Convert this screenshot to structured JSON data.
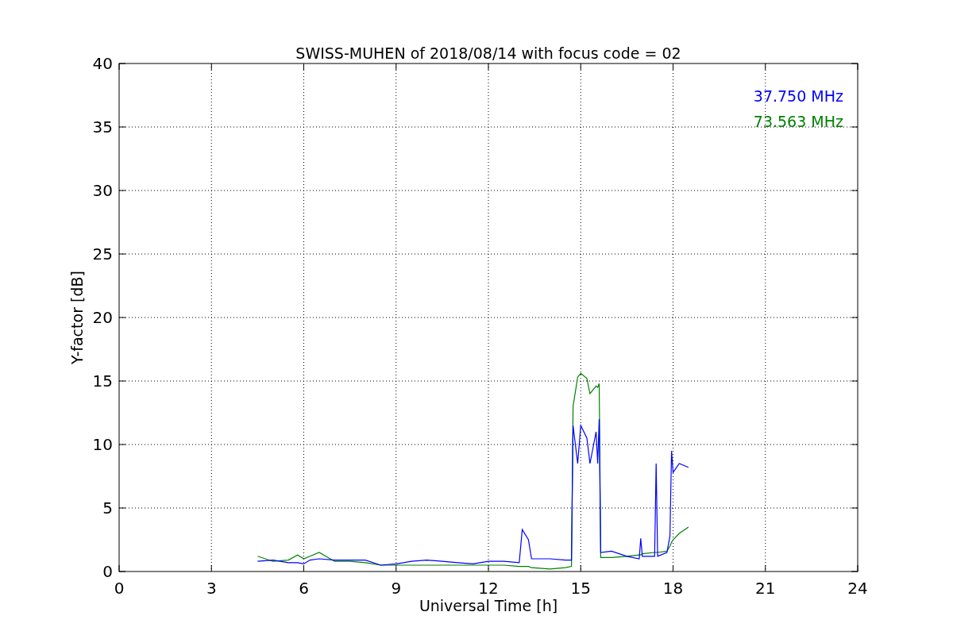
{
  "chart_data": {
    "type": "line",
    "title": "SWISS-MUHEN of 2018/08/14 with focus code = 02",
    "xlabel": "Universal Time [h]",
    "ylabel": "Y-factor [dB]",
    "x": [
      4.5,
      5,
      5.5,
      5.8,
      6,
      6.2,
      6.5,
      7,
      7.5,
      8,
      8.5,
      9,
      9.5,
      10,
      10.5,
      11,
      11.5,
      12,
      12.5,
      13,
      13.1,
      13.3,
      13.4,
      14,
      14.5,
      14.7,
      14.75,
      14.9,
      15,
      15.2,
      15.3,
      15.5,
      15.55,
      15.6,
      15.65,
      16,
      16.5,
      16.9,
      16.95,
      17,
      17.4,
      17.45,
      17.5,
      17.8,
      17.9,
      17.95,
      18,
      18.2,
      18.5
    ],
    "series": [
      {
        "name": "37.750 MHz",
        "color": "#0000ff",
        "values": [
          0.8,
          0.9,
          0.7,
          0.7,
          0.6,
          0.9,
          1.0,
          0.9,
          0.9,
          0.9,
          0.5,
          0.6,
          0.8,
          0.9,
          0.8,
          0.7,
          0.6,
          0.8,
          0.8,
          0.7,
          3.3,
          2.5,
          1.0,
          1.0,
          0.9,
          0.9,
          11.5,
          8.5,
          11.5,
          10.5,
          8.5,
          11,
          8.5,
          12,
          1.5,
          1.6,
          1.2,
          1.0,
          2.6,
          1.2,
          1.2,
          8.5,
          1.2,
          1.5,
          2.8,
          9.5,
          7.8,
          8.5,
          8.2
        ]
      },
      {
        "name": "73.563 MHz",
        "color": "#008000",
        "values": [
          1.2,
          0.8,
          0.9,
          1.3,
          1.0,
          1.2,
          1.5,
          0.8,
          0.8,
          0.7,
          0.5,
          0.5,
          0.5,
          0.5,
          0.5,
          0.5,
          0.5,
          0.5,
          0.5,
          0.4,
          0.4,
          0.4,
          0.3,
          0.2,
          0.3,
          0.4,
          13,
          15.3,
          15.6,
          15.2,
          14,
          14.6,
          14.5,
          14.8,
          1.1,
          1.1,
          1.2,
          1.3,
          1.3,
          1.4,
          1.5,
          1.5,
          1.5,
          1.6,
          2.0,
          2.3,
          2.5,
          3.0,
          3.5
        ]
      }
    ],
    "xlim": [
      0,
      24
    ],
    "ylim": [
      0,
      40
    ],
    "xticks": [
      0,
      3,
      6,
      9,
      12,
      15,
      18,
      21,
      24
    ],
    "yticks": [
      0,
      5,
      10,
      15,
      20,
      25,
      30,
      35,
      40
    ],
    "grid": true
  }
}
